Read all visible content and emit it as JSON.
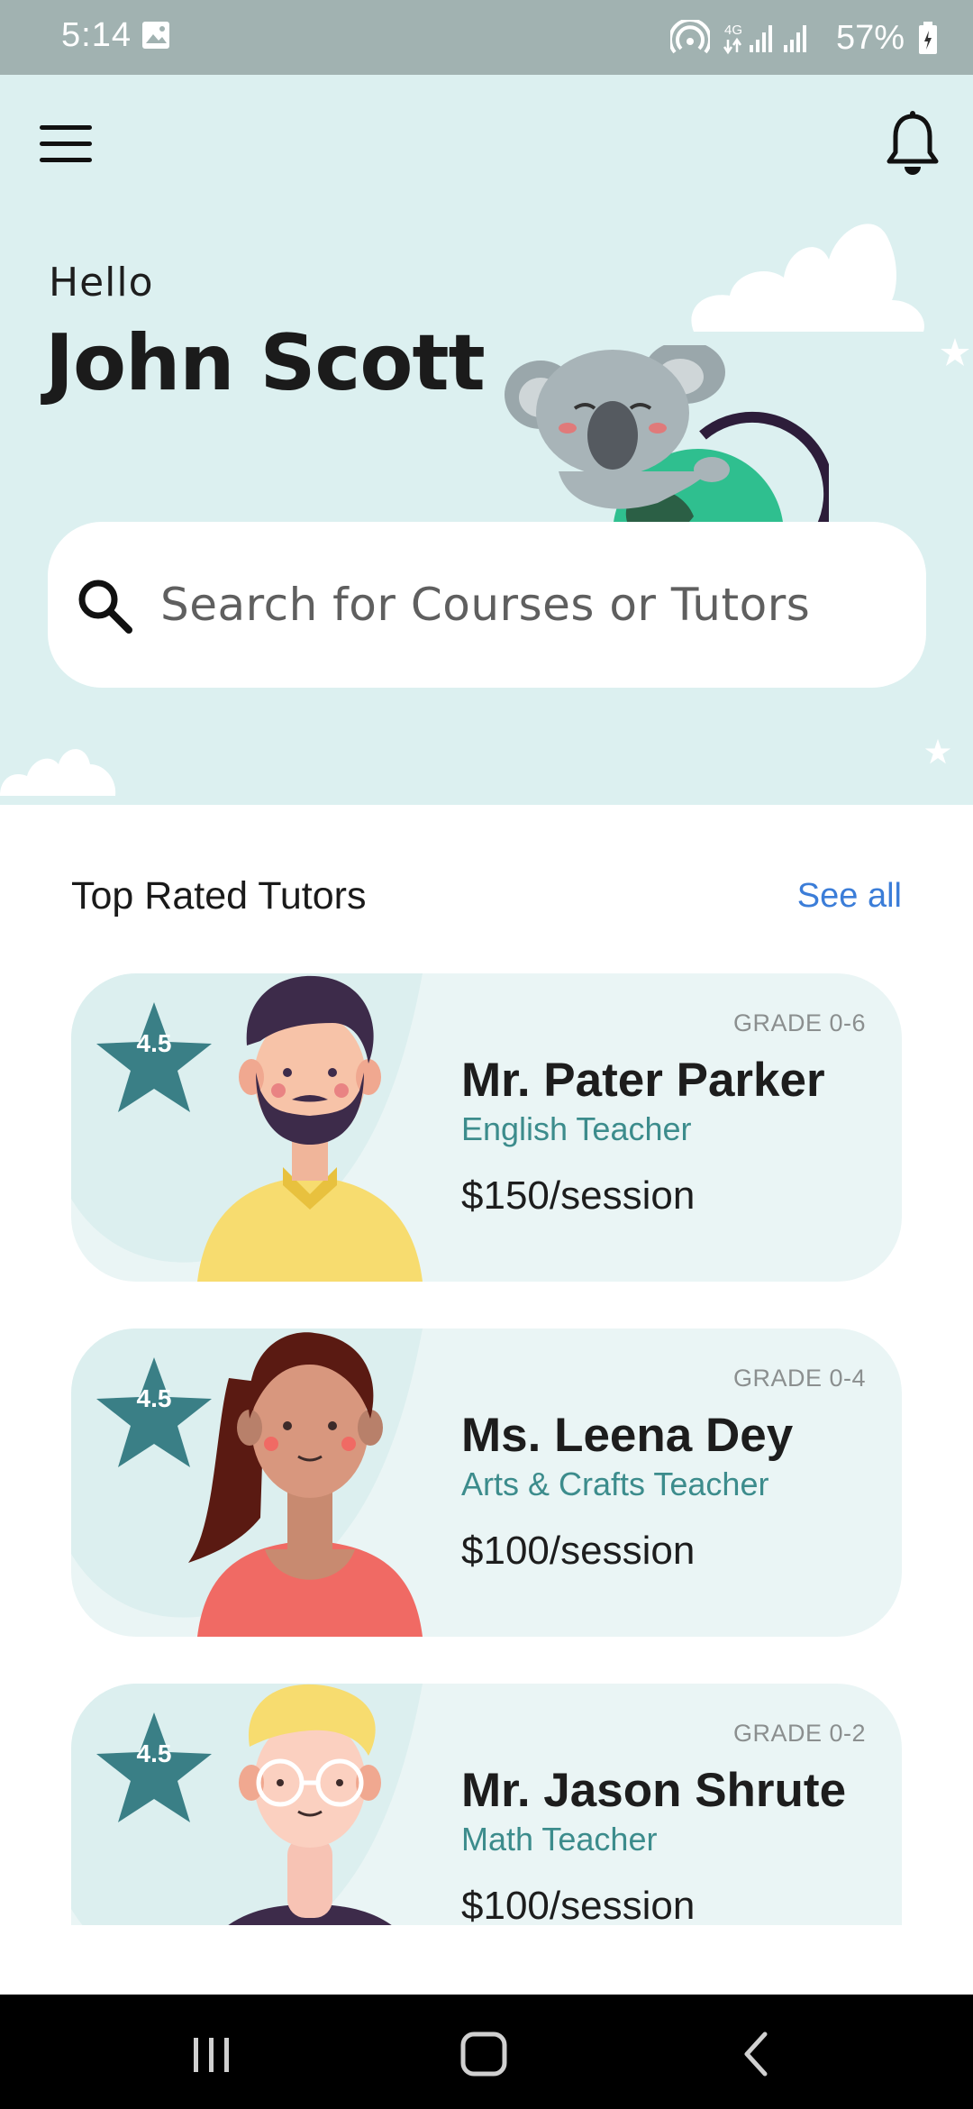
{
  "status_bar": {
    "time": "5:14",
    "battery": "57%",
    "network": "4G",
    "icons": [
      "gallery-icon",
      "hotspot-icon",
      "signal-icon",
      "battery-icon"
    ]
  },
  "header": {
    "greeting": "Hello",
    "user_name": "John Scott",
    "menu_icon": "menu-icon",
    "notification_icon": "bell-icon"
  },
  "search": {
    "placeholder": "Search for Courses or Tutors",
    "value": ""
  },
  "section": {
    "title": "Top Rated Tutors",
    "see_all": "See all"
  },
  "tutors": [
    {
      "rating": "4.5",
      "grade": "GRADE 0-6",
      "name": "Mr. Pater Parker",
      "subject": "English Teacher",
      "price": "$150/session"
    },
    {
      "rating": "4.5",
      "grade": "GRADE 0-4",
      "name": "Ms. Leena Dey",
      "subject": "Arts & Crafts Teacher",
      "price": "$100/session"
    },
    {
      "rating": "4.5",
      "grade": "GRADE 0-2",
      "name": "Mr. Jason Shrute",
      "subject": "Math Teacher",
      "price": "$100/session"
    }
  ],
  "colors": {
    "hero_bg": "#dcf0f0",
    "card_bg": "#eaf5f5",
    "accent_teal": "#3c8c8c",
    "star_teal": "#3a7f86",
    "link_blue": "#3b7dd8",
    "status_bar": "#a1b2b1"
  },
  "nav_bar": {
    "buttons": [
      "recent-apps-icon",
      "home-icon",
      "back-icon"
    ]
  }
}
